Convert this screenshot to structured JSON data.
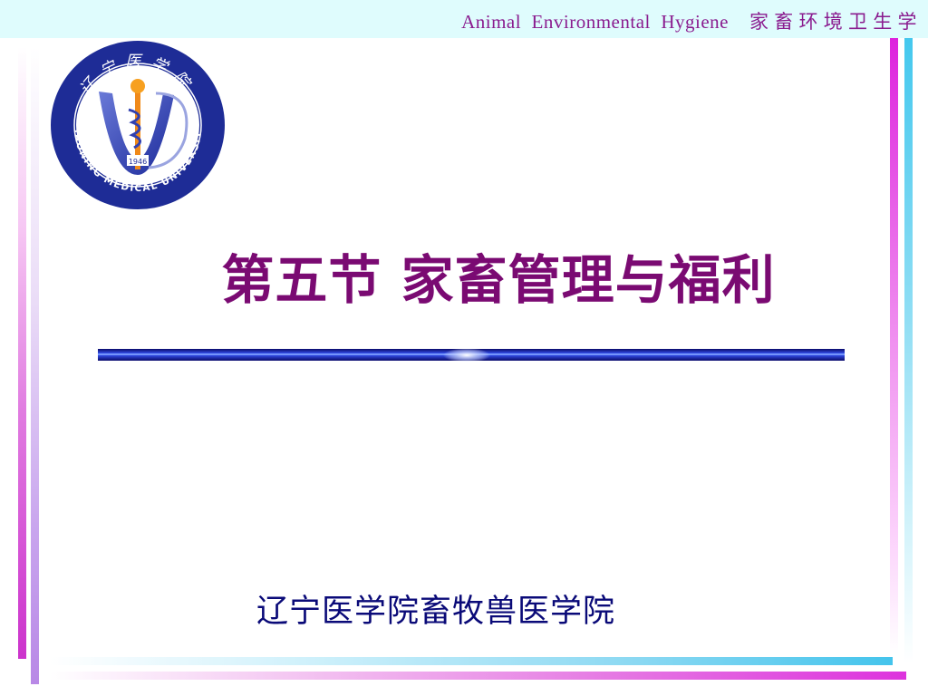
{
  "header": {
    "text": "Animal  Environmental  Hygiene    家 畜 环 境 卫 生 学"
  },
  "logo": {
    "icon": "university-emblem-icon",
    "year": "1946",
    "outer_text": "LIAONING MEDICAL UNIVERSITY",
    "top_text": "辽宁医学院"
  },
  "slide": {
    "title": "第五节 家畜管理与福利",
    "institution": "辽宁医学院畜牧兽医学院"
  },
  "colors": {
    "header_bg": "#dffcfd",
    "header_text": "#8a1c8f",
    "title": "#7a0a72",
    "institution": "#0a0a78",
    "divider": "#1a1aa8"
  }
}
